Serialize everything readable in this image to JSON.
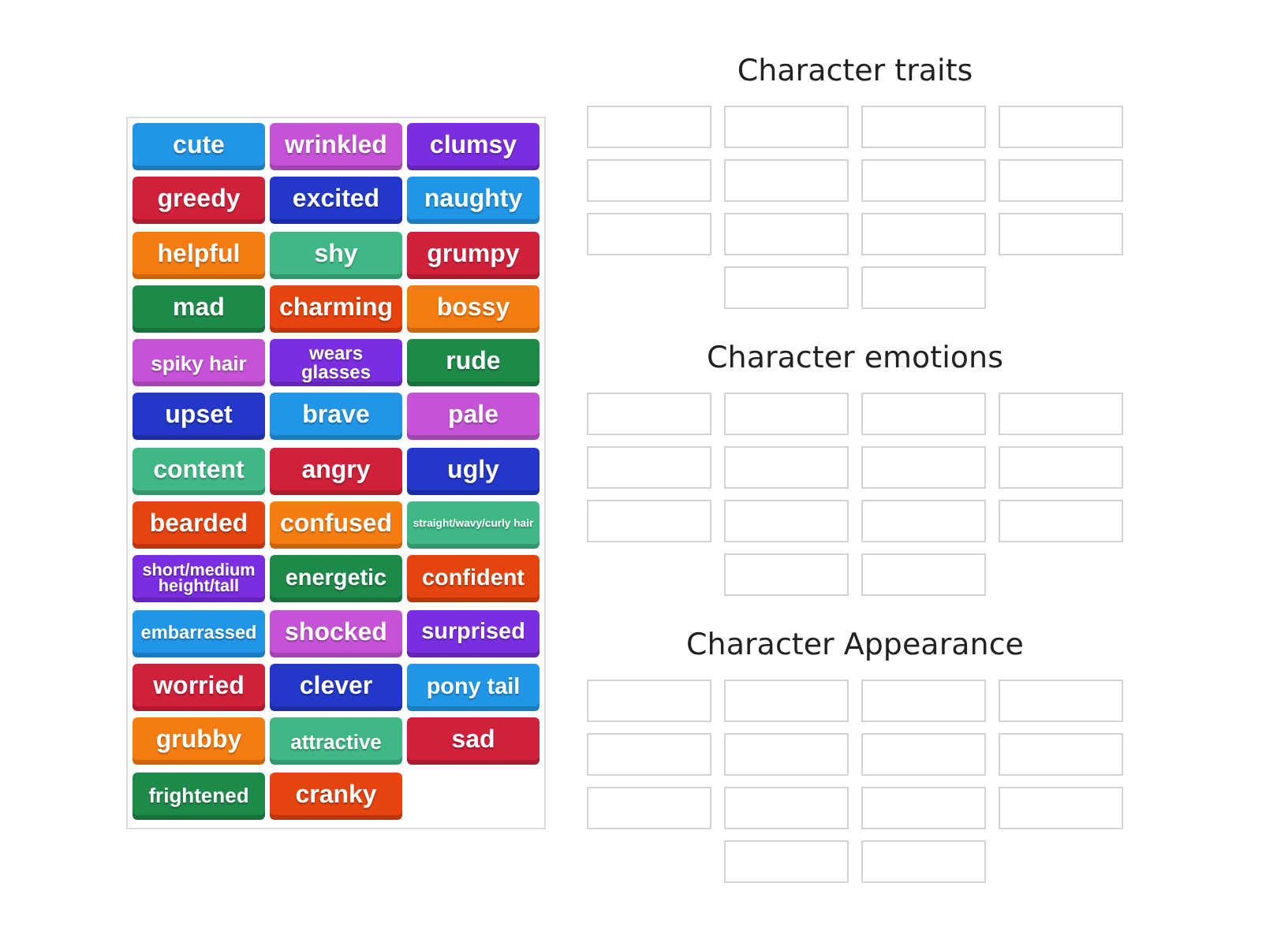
{
  "tiles": [
    {
      "label": "cute",
      "color": "#2196e6"
    },
    {
      "label": "wrinkled",
      "color": "#c553d6"
    },
    {
      "label": "clumsy",
      "color": "#7b2ee0"
    },
    {
      "label": "greedy",
      "color": "#d1203a"
    },
    {
      "label": "excited",
      "color": "#2337c9"
    },
    {
      "label": "naughty",
      "color": "#2196e6"
    },
    {
      "label": "helpful",
      "color": "#f57c10"
    },
    {
      "label": "shy",
      "color": "#3fb886"
    },
    {
      "label": "grumpy",
      "color": "#d1203a"
    },
    {
      "label": "mad",
      "color": "#1e8a4a"
    },
    {
      "label": "charming",
      "color": "#e5430f"
    },
    {
      "label": "bossy",
      "color": "#f57c10"
    },
    {
      "label": "spiky hair",
      "color": "#c553d6"
    },
    {
      "label": "wears glasses",
      "color": "#7b2ee0"
    },
    {
      "label": "rude",
      "color": "#1e8a4a"
    },
    {
      "label": "upset",
      "color": "#2337c9"
    },
    {
      "label": "brave",
      "color": "#2196e6"
    },
    {
      "label": "pale",
      "color": "#c553d6"
    },
    {
      "label": "content",
      "color": "#3fb886"
    },
    {
      "label": "angry",
      "color": "#d1203a"
    },
    {
      "label": "ugly",
      "color": "#2337c9"
    },
    {
      "label": "bearded",
      "color": "#e5430f"
    },
    {
      "label": "confused",
      "color": "#f57c10"
    },
    {
      "label": "straight/wavy/curly hair",
      "color": "#3fb886"
    },
    {
      "label": "short/medium height/tall",
      "color": "#7b2ee0"
    },
    {
      "label": "energetic",
      "color": "#1e8a4a"
    },
    {
      "label": "confident",
      "color": "#e5430f"
    },
    {
      "label": "embarrassed",
      "color": "#2196e6"
    },
    {
      "label": "shocked",
      "color": "#c553d6"
    },
    {
      "label": "surprised",
      "color": "#7b2ee0"
    },
    {
      "label": "worried",
      "color": "#d1203a"
    },
    {
      "label": "clever",
      "color": "#2337c9"
    },
    {
      "label": "pony tail",
      "color": "#2196e6"
    },
    {
      "label": "grubby",
      "color": "#f57c10"
    },
    {
      "label": "attractive",
      "color": "#3fb886"
    },
    {
      "label": "sad",
      "color": "#d1203a"
    },
    {
      "label": "frightened",
      "color": "#1e8a4a"
    },
    {
      "label": "cranky",
      "color": "#e5430f"
    }
  ],
  "groups": [
    {
      "title": "Character traits"
    },
    {
      "title": "Character emotions"
    },
    {
      "title": "Character Appearance"
    }
  ]
}
